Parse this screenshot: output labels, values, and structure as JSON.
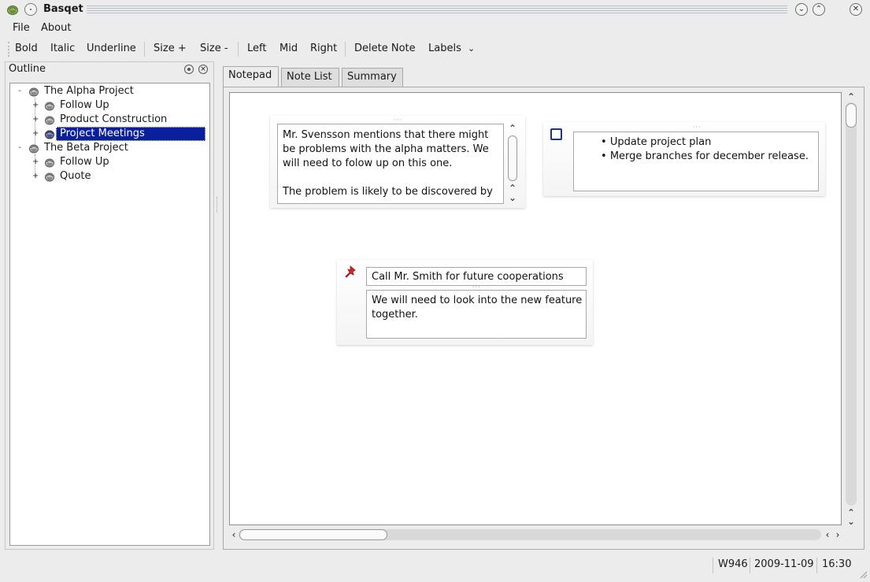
{
  "window": {
    "title": "Basqet"
  },
  "menu": {
    "items": [
      "File",
      "About"
    ]
  },
  "toolbar": {
    "bold": "Bold",
    "italic": "Italic",
    "underline": "Underline",
    "size_plus": "Size +",
    "size_minus": "Size -",
    "left": "Left",
    "mid": "Mid",
    "right": "Right",
    "delete_note": "Delete Note",
    "labels": "Labels"
  },
  "outline": {
    "title": "Outline",
    "tree": [
      {
        "label": "The Alpha Project",
        "expander": "-",
        "level": 0
      },
      {
        "label": "Follow Up",
        "expander": "+",
        "level": 1
      },
      {
        "label": "Product Construction",
        "expander": "+",
        "level": 1
      },
      {
        "label": "Project Meetings",
        "expander": "+",
        "level": 1,
        "selected": true
      },
      {
        "label": "The Beta Project",
        "expander": "-",
        "level": 0
      },
      {
        "label": "Follow Up",
        "expander": "+",
        "level": 1
      },
      {
        "label": "Quote",
        "expander": "+",
        "level": 1
      }
    ]
  },
  "tabs": [
    {
      "label": "Notepad",
      "active": true
    },
    {
      "label": "Note List",
      "active": false
    },
    {
      "label": "Summary",
      "active": false
    }
  ],
  "notes": {
    "meeting_note": {
      "lines": [
        "Mr. Svensson mentions that there might",
        "be problems with the alpha matters. We",
        "will need to folow up on this one.",
        "",
        "The problem is likely to be discovered by"
      ]
    },
    "todo_note": {
      "checked": false,
      "items": [
        "Update project plan",
        "Merge branches for december release."
      ]
    },
    "task_note": {
      "title": "Call Mr. Smith for future cooperations",
      "body_lines": [
        "We will need to look into the new feature",
        "together."
      ]
    }
  },
  "statusbar": {
    "word": "W946",
    "date": "2009-11-09",
    "time": "16:30"
  },
  "colors": {
    "selection": "#0a1f9b",
    "checkbox": "#1c2fa0",
    "pin": "#d8262c"
  }
}
